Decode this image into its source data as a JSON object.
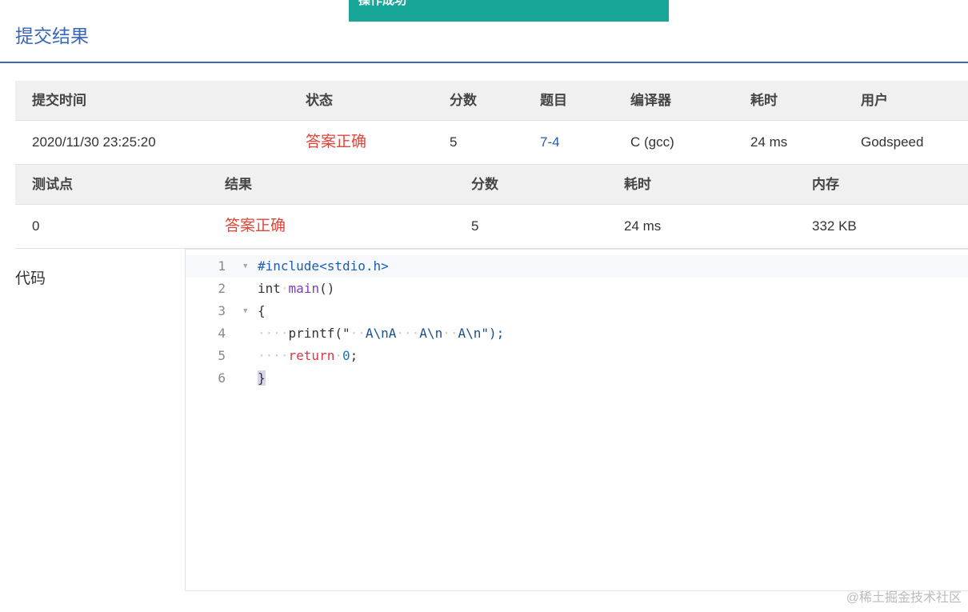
{
  "toast": "操作成功",
  "title": "提交结果",
  "summary": {
    "headers": [
      "提交时间",
      "状态",
      "分数",
      "题目",
      "编译器",
      "耗时",
      "用户"
    ],
    "values": [
      "2020/11/30 23:25:20",
      "答案正确",
      "5",
      "7-4",
      "C (gcc)",
      "24 ms",
      "Godspeed"
    ]
  },
  "tests": {
    "headers": [
      "测试点",
      "结果",
      "分数",
      "耗时",
      "内存"
    ],
    "values": [
      "0",
      "答案正确",
      "5",
      "24 ms",
      "332 KB"
    ]
  },
  "code_label": "代码",
  "code": {
    "line_numbers": [
      "1",
      "2",
      "3",
      "4",
      "5",
      "6"
    ],
    "l1": "#include<stdio.h>",
    "l2a": "int",
    "l2b": "main",
    "l2c": "()",
    "l3": "{",
    "l4a": "printf(\"",
    "l4b": "A\\nA",
    "l4c": "A\\n",
    "l4d": "A\\n\");",
    "l5a": "return",
    "l5b": "0",
    "l5c": ";",
    "l6": "}"
  },
  "watermark": "@稀土掘金技术社区"
}
